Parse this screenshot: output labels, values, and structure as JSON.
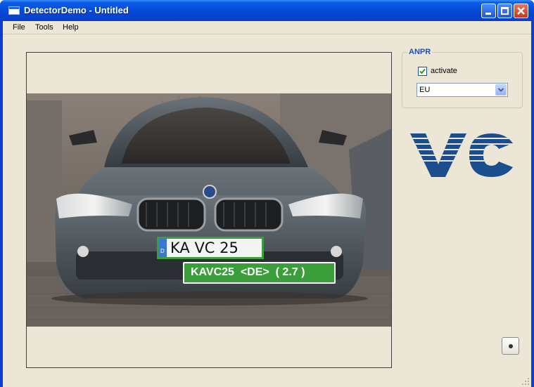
{
  "window": {
    "title": "DetectorDemo - Untitled",
    "controls": [
      "minimize",
      "maximize",
      "close"
    ]
  },
  "menubar": {
    "items": [
      {
        "label": "File"
      },
      {
        "label": "Tools"
      },
      {
        "label": "Help"
      }
    ]
  },
  "anpr": {
    "group_label": "ANPR",
    "activate_label": "activate",
    "activate_checked": true,
    "region_value": "EU"
  },
  "detection": {
    "plate_text": "KA VC 25",
    "plate_country_badge": "D",
    "result_text": "KAVC25  <DE>  ( 2.7 )"
  },
  "logo": {
    "text": "VC",
    "color": "#1a4e8c"
  },
  "colors": {
    "titlebar": "#0a5ee8",
    "client_bg": "#ece6d6",
    "detection_box": "#3a9e3a"
  }
}
